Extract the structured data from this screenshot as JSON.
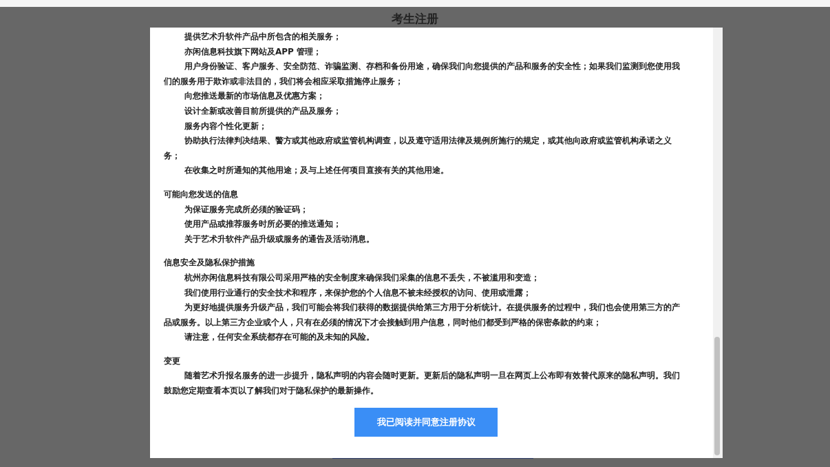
{
  "background_page": {
    "title": "考生注册"
  },
  "dialog": {
    "sections": [
      {
        "paragraphs": [
          "提供艺术升软件产品中所包含的相关服务；",
          "亦闲信息科技旗下网站及APP 管理；",
          "用户身份验证、客户服务、安全防范、诈骗监测、存档和备份用途，确保我们向您提供的产品和服务的安全性；如果我们监测到您使用我们的服务用于欺诈或非法目的，我们将会相应采取措施停止服务；",
          "向您推送最新的市场信息及优惠方案；",
          "设计全新或改善目前所提供的产品及服务；",
          "服务内容个性化更新；",
          "协助执行法律判决结果、警方或其他政府或监管机构调查，以及遵守适用法律及规例所施行的规定，或其他向政府或监管机构承诺之义务；",
          "在收集之时所通知的其他用途；及与上述任何项目直接有关的其他用途。"
        ]
      },
      {
        "heading": "可能向您发送的信息",
        "paragraphs": [
          "为保证服务完成所必须的验证码；",
          "使用产品或推荐服务时所必要的推送通知；",
          "关于艺术升软件产品升级或服务的通告及活动消息。"
        ]
      },
      {
        "heading": "信息安全及隐私保护措施",
        "paragraphs": [
          "杭州亦闲信息科技有限公司采用严格的安全制度来确保我们采集的信息不丢失，不被滥用和变造；",
          "我们使用行业通行的安全技术和程序，来保护您的个人信息不被未经授权的访问、使用或泄露；",
          "为更好地提供服务升级产品，我们可能会将我们获得的数据提供给第三方用于分析统计。在提供服务的过程中，我们也会使用第三方的产品或服务。以上第三方企业或个人，只有在必须的情况下才会接触到用户信息，同时他们都受到严格的保密条款的约束；",
          "请注意，任何安全系统都存在可能的及未知的风险。"
        ]
      },
      {
        "heading": "变更",
        "paragraphs": [
          "随着艺术升报名服务的进一步提升，隐私声明的内容会随时更新。更新后的隐私声明一旦在网页上公布即有效替代原来的隐私声明。我们鼓励您定期查看本页以了解我们对于隐私保护的最新操作。"
        ]
      }
    ],
    "agree_button": "我已阅读并同意注册协议"
  }
}
